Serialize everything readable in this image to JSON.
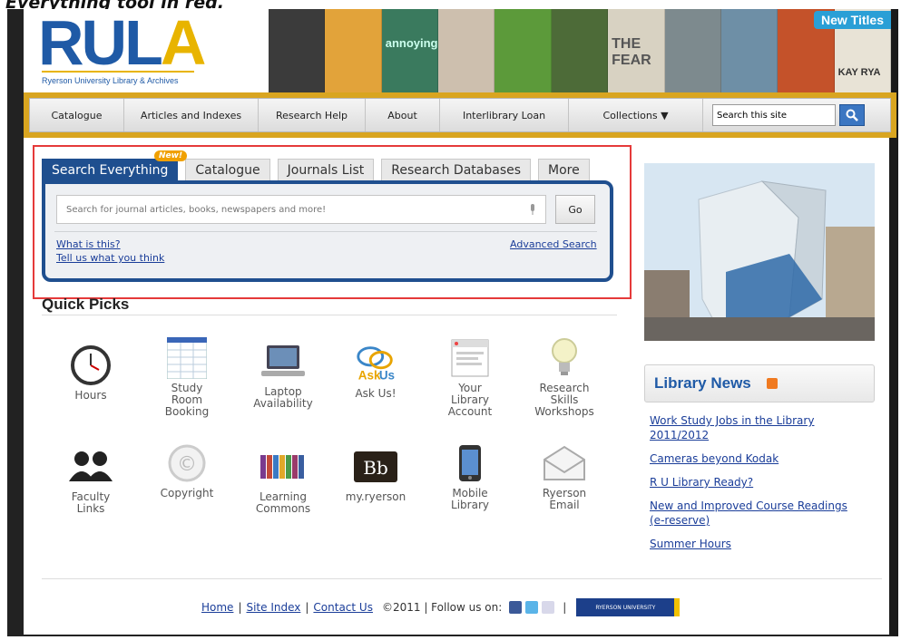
{
  "caption": "Everything tool in red.",
  "header": {
    "logo_rul": "RUL",
    "logo_a": "A",
    "logo_subtitle": "Ryerson University Library & Archives",
    "banner_titles": [
      "",
      "",
      "annoying",
      "",
      "",
      "",
      "THE FEAR",
      "",
      "",
      "",
      "KAY RYA"
    ],
    "new_titles_label": "New Titles"
  },
  "nav": {
    "items": [
      "Catalogue",
      "Articles and Indexes",
      "Research Help",
      "About",
      "Interlibrary Loan",
      "Collections ▼"
    ],
    "search_placeholder": "Search this site"
  },
  "search": {
    "tabs": [
      "Search Everything",
      "Catalogue",
      "Journals List",
      "Research Databases",
      "More"
    ],
    "new_badge": "New!",
    "input_placeholder": "Search for journal articles, books, newspapers and more!",
    "go_label": "Go",
    "what_is_this": "What is this?",
    "tell_us": "Tell us what you think",
    "advanced": "Advanced Search"
  },
  "quick_picks": {
    "title": "Quick Picks",
    "items": [
      {
        "label": "Hours",
        "icon": "clock-icon"
      },
      {
        "label": "Study\nRoom\nBooking",
        "icon": "calendar-grid-icon"
      },
      {
        "label": "Laptop\nAvailability",
        "icon": "laptop-icon"
      },
      {
        "label": "Ask Us!",
        "icon": "askus-bubble-icon"
      },
      {
        "label": "Your\nLibrary\nAccount",
        "icon": "account-window-icon"
      },
      {
        "label": "Research\nSkills\nWorkshops",
        "icon": "lightbulb-icon"
      },
      {
        "label": "Faculty\nLinks",
        "icon": "people-icon"
      },
      {
        "label": "Copyright",
        "icon": "copyright-icon"
      },
      {
        "label": "Learning\nCommons",
        "icon": "books-icon"
      },
      {
        "label": "my.ryerson",
        "icon": "blackboard-icon"
      },
      {
        "label": "Mobile\nLibrary",
        "icon": "phone-icon"
      },
      {
        "label": "Ryerson\nEmail",
        "icon": "envelope-icon"
      }
    ]
  },
  "news": {
    "title": "Library News",
    "items": [
      "Work Study Jobs in the Library 2011/2012",
      "Cameras beyond Kodak",
      "R U Library Ready?",
      "New and Improved Course Readings (e-reserve)",
      "Summer Hours"
    ]
  },
  "footer": {
    "home": "Home",
    "site_index": "Site Index",
    "contact": "Contact Us",
    "copyright": "©2011 | Follow us on:",
    "ru_logo_text": "RYERSON UNIVERSITY"
  },
  "colors": {
    "brand_blue": "#1f5aa6",
    "brand_gold": "#e8b400",
    "highlight_red": "#e53a3a"
  }
}
